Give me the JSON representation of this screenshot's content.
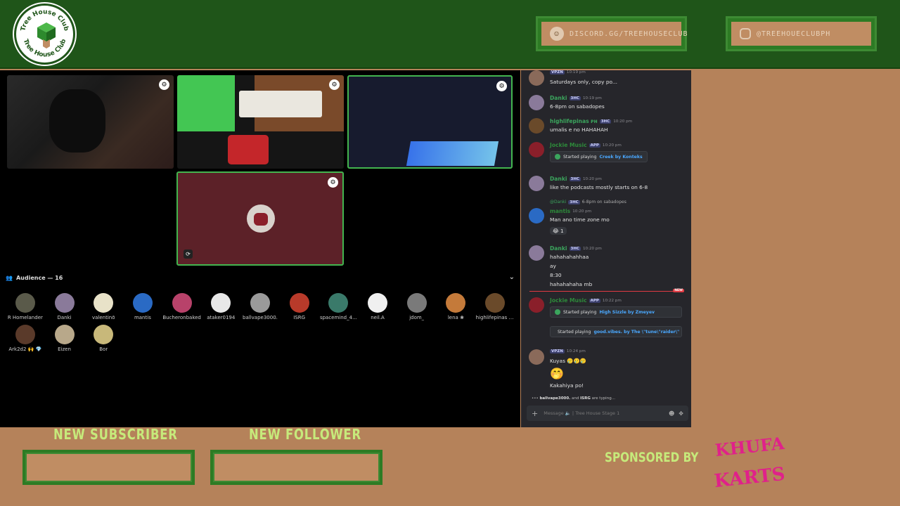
{
  "branding": {
    "logo_text_top": "Tree House Club",
    "logo_text_bottom": "Tree House Club",
    "discord": "DISCORD.GG/TREEHOUSECLUB",
    "instagram": "@TREEHOUECLUBPH"
  },
  "colors": {
    "topbar": "#1f5519",
    "frame": "#2d7b24",
    "tan": "#c08d63",
    "accent_green": "#c6ea7b",
    "speaking_outline": "#43b54f"
  },
  "stage": {
    "audience_label": "Audience — 16",
    "audience": [
      {
        "name": "R Homelander",
        "color": "#5a5a4a"
      },
      {
        "name": "Danki",
        "color": "#8a7a9a"
      },
      {
        "name": "valentinō",
        "color": "#e8e2c8"
      },
      {
        "name": "mantis",
        "color": "#2a6ac4"
      },
      {
        "name": "Bucheronbaked",
        "color": "#b8426a"
      },
      {
        "name": "ataker0194",
        "color": "#e8e8e8"
      },
      {
        "name": "ballvape3000.",
        "color": "#9a9a9a"
      },
      {
        "name": "ISRG",
        "color": "#b83a2a"
      },
      {
        "name": "spacemind_4...",
        "color": "#3a7a6a"
      },
      {
        "name": "neil.A",
        "color": "#f0f0f0"
      },
      {
        "name": "jdom_",
        "color": "#7a7a7a"
      },
      {
        "name": "lena ❀",
        "color": "#c47a3a"
      },
      {
        "name": "highlifepinas ᴘʜ",
        "color": "#6a4a2a"
      },
      {
        "name": "Ark2d2 🙌 💎",
        "color": "#5a3a2a"
      },
      {
        "name": "Eizen",
        "color": "#b8a88a"
      },
      {
        "name": "Bor",
        "color": "#c8b87a"
      }
    ]
  },
  "chat": {
    "messages": [
      {
        "user": "",
        "tag": "VPZN",
        "time": "10:19 pm",
        "lines": [
          "Saturdays only, copy po..."
        ],
        "avatar": "#8a6a5a",
        "user_color": "#3ba55d"
      },
      {
        "user": "Danki",
        "tag": "3HC",
        "time": "10:19 pm",
        "lines": [
          "6-8pm on sabadopes"
        ],
        "avatar": "#8a7a9a",
        "user_color": "#3ba55d"
      },
      {
        "user": "highlifepinas ᴘʜ",
        "tag": "3HC",
        "time": "10:20 pm",
        "lines": [
          "umalis e no HAHAHAH"
        ],
        "avatar": "#6a4a2a",
        "user_color": "#3ba55d"
      },
      {
        "user": "Jockie Music",
        "tag": "APP",
        "time": "10:20 pm",
        "embed_prefix": "Started playing",
        "embed_song": "Creek by Konteks",
        "avatar": "#8a1f2a",
        "user_color": "#2d8a3a"
      },
      {
        "user": "Danki",
        "tag": "3HC",
        "time": "10:20 pm",
        "lines": [
          "like the podcasts mostly starts on 6-8"
        ],
        "avatar": "#8a7a9a",
        "user_color": "#3ba55d"
      },
      {
        "reply_user": "@Danki",
        "reply_tag": "3HC",
        "reply_text": "6-8pm on sabadopes",
        "user": "mantis",
        "time": "10:20 pm",
        "lines": [
          "Man ano time zone mo"
        ],
        "reaction": "😂 1",
        "avatar": "#2a6ac4",
        "user_color": "#2d8a3a"
      },
      {
        "user": "Danki",
        "tag": "3HC",
        "time": "10:20 pm",
        "lines": [
          "hahahahahhaa",
          "ay",
          "8:30",
          "hahahahaha mb"
        ],
        "avatar": "#8a7a9a",
        "user_color": "#3ba55d"
      },
      {
        "user": "Jockie Music",
        "tag": "APP",
        "time": "10:22 pm",
        "embeds": [
          {
            "prefix": "Started playing",
            "song": "High Sizzle by Zmeyev"
          },
          {
            "prefix": "Started playing",
            "song": "good.vibes. by The \\\"tune\\\"raider\\\""
          }
        ],
        "avatar": "#8a1f2a",
        "user_color": "#2d8a3a"
      },
      {
        "user": "",
        "tag": "VPZN",
        "time": "10:24 pm",
        "lines": [
          "Kuyas 🥲🥲🥲",
          "🤭",
          "Kakahiya po!"
        ],
        "avatar": "#8a6a5a",
        "user_color": "#3ba55d"
      }
    ],
    "new_label": "NEW",
    "typing": {
      "users": "ballvape3000.",
      "and": "and",
      "user2": "ISRG",
      "suffix": "are typing..."
    },
    "composer_placeholder": "Message 🔈 | Tree House Stage 1"
  },
  "alerts": {
    "subscriber_label": "NEW SUBSCRIBER",
    "follower_label": "NEW FOLLOWER",
    "sponsor_label": "SPONSORED BY",
    "sponsor_logo_text": "KHUFA KARTS"
  }
}
